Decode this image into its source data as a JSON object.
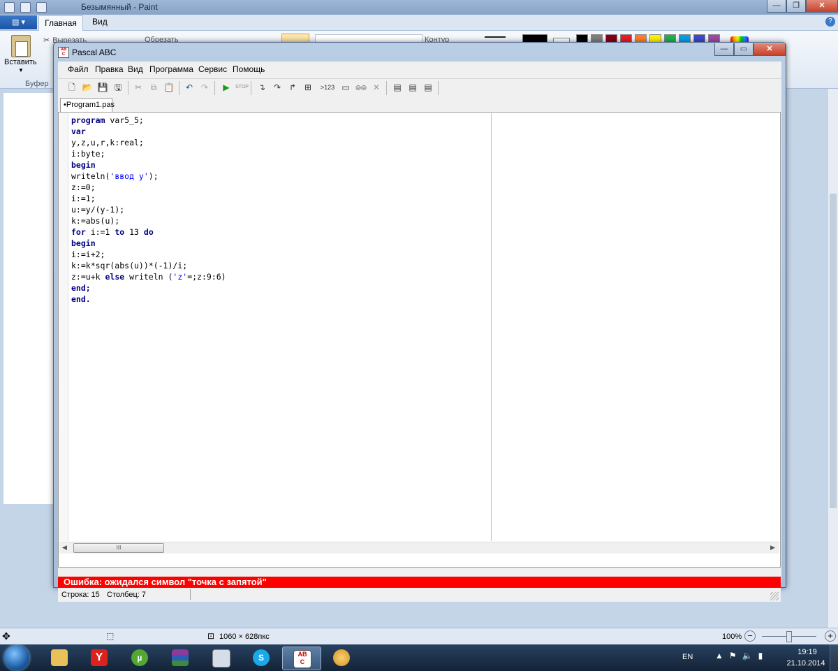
{
  "paint": {
    "title": "Безымянный - Paint",
    "tabs": {
      "file_icon": "menu-icon",
      "home": "Главная",
      "view": "Вид"
    },
    "ribbon": {
      "paste": "Вставить",
      "cut": "Вырезать",
      "crop": "Обрезать",
      "outline": "Контур",
      "clipboard_group": "Буфер о"
    },
    "palette": [
      "#000000",
      "#7f7f7f",
      "#880015",
      "#ed1c24",
      "#ff7f27",
      "#fff200",
      "#22b14c",
      "#00a2e8",
      "#3f48cc",
      "#a349a4",
      "#ffffff",
      "#c3c3c3",
      "#b97a57",
      "#ffaec9",
      "#ffc90e",
      "#efe4b0",
      "#b5e61d",
      "#99d9ea",
      "#7092be",
      "#c8bfe7"
    ],
    "status": {
      "size": "1060 × 628пкс",
      "zoom": "100%"
    }
  },
  "pascal": {
    "title": "Pascal ABC",
    "app_icon": "AB C",
    "menu": [
      "Файл",
      "Правка",
      "Вид",
      "Программа",
      "Сервис",
      "Помощь"
    ],
    "tab": "•Program1.pas",
    "code_lines": [
      [
        {
          "t": "program",
          "k": "kw"
        },
        {
          "t": " var5_5;"
        }
      ],
      [
        {
          "t": "var",
          "k": "kw"
        }
      ],
      [
        {
          "t": "y,z,u,r,k:real;"
        }
      ],
      [
        {
          "t": "i:byte;"
        }
      ],
      [
        {
          "t": "begin",
          "k": "kw"
        }
      ],
      [
        {
          "t": "writeln("
        },
        {
          "t": "'ввод y'",
          "k": "str"
        },
        {
          "t": ");"
        }
      ],
      [
        {
          "t": "z:=0;"
        }
      ],
      [
        {
          "t": "i:=1;"
        }
      ],
      [
        {
          "t": "u:=y/(y-1);"
        }
      ],
      [
        {
          "t": "k:=abs(u);"
        }
      ],
      [
        {
          "t": "for",
          "k": "kw"
        },
        {
          "t": " i:=1 "
        },
        {
          "t": "to",
          "k": "kw"
        },
        {
          "t": " 13 "
        },
        {
          "t": "do",
          "k": "kw"
        }
      ],
      [
        {
          "t": "begin",
          "k": "kw"
        }
      ],
      [
        {
          "t": "i:=i+2;"
        }
      ],
      [
        {
          "t": "k:=k*sqr(abs(u))*(-1)/i;"
        }
      ],
      [
        {
          "t": "z:=u+k "
        },
        {
          "t": "else",
          "k": "kw"
        },
        {
          "t": " writeln ("
        },
        {
          "t": "'z'",
          "k": "str"
        },
        {
          "t": "=;z:9:6)"
        }
      ],
      [
        {
          "t": "end;",
          "k": "kw"
        }
      ],
      [
        {
          "t": "end.",
          "k": "kw"
        }
      ]
    ],
    "scroll_thumb": "III",
    "error": "Ошибка: ожидался символ \"точка с запятой\"",
    "status": {
      "line": "Строка: 15",
      "col": "Столбец: 7"
    },
    "toolbar_icons": [
      "new-file",
      "open-folder",
      "save",
      "save-all",
      "cut",
      "copy",
      "paste",
      "undo",
      "redo",
      "run",
      "stop",
      "step-into",
      "step-over",
      "step-out",
      "add-watch",
      "int-eval",
      "output-window",
      "compile",
      "debug-stop",
      "format",
      "help-1",
      "help-2"
    ],
    "toolbar_label_123": ">123"
  },
  "taskbar": {
    "apps": [
      "file-explorer",
      "yandex-browser",
      "utorrent",
      "winrar",
      "calculator",
      "skype",
      "pascal-abc",
      "paint"
    ],
    "lang": "EN",
    "time": "19:19",
    "date": "21.10.2014"
  }
}
